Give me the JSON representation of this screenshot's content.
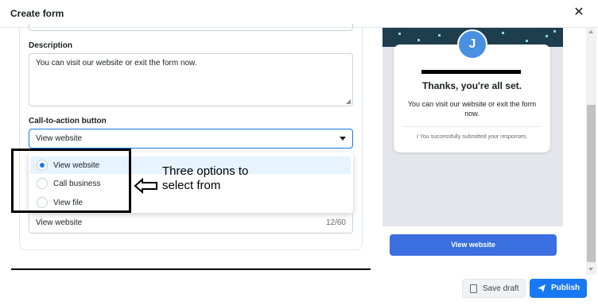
{
  "dialog": {
    "title": "Create form",
    "close_icon": "close-icon"
  },
  "form": {
    "description_label": "Description",
    "description_value": "You can visit our website or exit the form now.",
    "cta_label": "Call-to-action button",
    "cta_selected": "View website",
    "cta_options": [
      {
        "label": "View website",
        "selected": true
      },
      {
        "label": "Call business",
        "selected": false
      },
      {
        "label": "View file",
        "selected": false
      }
    ],
    "button_text_value": "View website",
    "button_text_counter": "12/60"
  },
  "annotation": {
    "line1": "Three options to",
    "line2": "select from"
  },
  "preview": {
    "avatar_letter": "J",
    "thanks_title": "Thanks, you're all set.",
    "thanks_description": "You can visit our website or exit the form now.",
    "submitted_note": "You successfully submitted your responses.",
    "button_label": "View website"
  },
  "footer": {
    "save_draft_label": "Save draft",
    "publish_label": "Publish"
  },
  "colors": {
    "accent": "#1877f2",
    "preview_button": "#3b6fe0",
    "avatar": "#4a90e2"
  }
}
